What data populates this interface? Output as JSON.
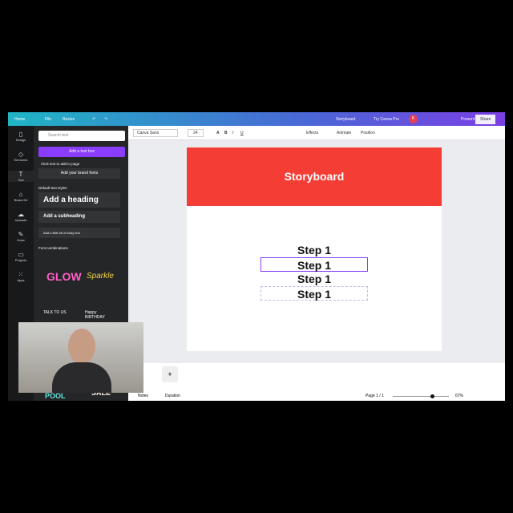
{
  "topbar": {
    "home": "Home",
    "file": "File",
    "resize": "Resize",
    "title": "Storyboard",
    "try_pro": "Try Canva Pro",
    "avatar": "K",
    "present": "Present",
    "share": "Share"
  },
  "rail": [
    "Design",
    "Elements",
    "Text",
    "Brand Kit",
    "Uploads",
    "Draw",
    "Projects",
    "Apps"
  ],
  "panel": {
    "search_placeholder": "Search text",
    "add_textbox": "Add a text box",
    "click_hint": "Click text to add to page",
    "brand_fonts": "Add your brand fonts",
    "default_styles": "Default text styles",
    "heading": "Add a heading",
    "subheading": "Add a subheading",
    "body": "Add a little bit of body text",
    "combinations": "Font combinations",
    "combo1": "GLOW",
    "combo2": "Sparkle",
    "combo3": "TALK TO US",
    "combo4": "Happy BIRTHDAY",
    "combo5": "POOL",
    "combo6": "SALE"
  },
  "toolbar": {
    "font": "Canva Sans",
    "size": "24",
    "effects": "Effects",
    "animate": "Animate",
    "position": "Position"
  },
  "page": {
    "title": "Storyboard",
    "steps": [
      "Step 1",
      "Step 1",
      "Step 1",
      "Step 1"
    ]
  },
  "footer": {
    "notes": "Notes",
    "duration": "Duration",
    "page": "Page 1 / 1",
    "zoom": "67%",
    "zoom_level": 67
  },
  "colors": {
    "accent": "#8b3dff",
    "header": "#f33d35"
  }
}
